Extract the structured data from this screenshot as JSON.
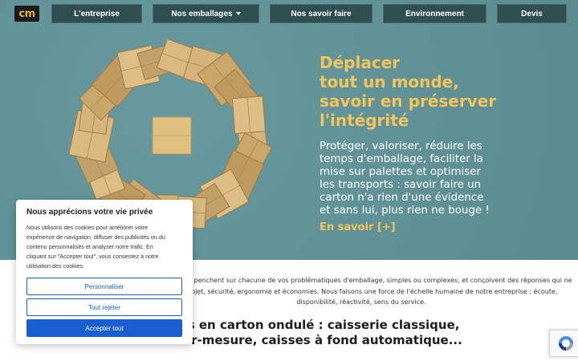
{
  "logo": {
    "text": "cm"
  },
  "nav": {
    "items": [
      {
        "label": "L'entreprise"
      },
      {
        "label": "Nos emballages"
      },
      {
        "label": "Nos savoir faire"
      },
      {
        "label": "Environnement"
      },
      {
        "label": "Devis"
      }
    ]
  },
  "hero": {
    "title_lines": [
      "Déplacer",
      "tout un monde,",
      "savoir en préserver",
      "l'intégrité"
    ],
    "text_lines": [
      "Protéger, valoriser, réduire les",
      "temps d'emballage, faciliter la",
      "mise sur palettes et optimiser",
      "les transports : savoir faire un",
      "carton n'a rien d'une évidence",
      "et sans lui, plus rien ne bouge !"
    ],
    "link": "En savoir [+]"
  },
  "intro": {
    "lines": [
      "se penchent sur chacune de vos problématiques d'emballage, simples ou complexes, et conçoivent des réponses qui ne",
      "projet, sécurité, ergonomie et économies. Nous faisons une force de l'échelle humaine de notre entreprise : écoute,",
      "disponibilité, réactivité, sens du service."
    ]
  },
  "heading2": {
    "lines": [
      "lages en carton ondulé : caisserie classique,",
      "es sur-mesure, caisses à fond automatique..."
    ]
  },
  "cookie": {
    "title": "Nous apprécions votre vie privée",
    "body_lines": [
      "Nous utilisons des cookies pour améliorer votre",
      "expérience de navigation, diffuser des publicités ou du",
      "contenu personnalisés et analyser notre trafic. En",
      "cliquant sur \"Accepter tout\", vous consentez à notre",
      "utilisation des cookies."
    ],
    "customize": "Personnaliser",
    "reject": "Tout rejeter",
    "accept": "Accepter tout"
  },
  "colors": {
    "hero_bg": "#5f9399",
    "nav_bg": "#2f4f50",
    "accent": "#f2c45a",
    "button_blue": "#1a5fd1"
  },
  "icons": {
    "recaptcha": "recaptcha-icon",
    "caret": "chevron-down-icon"
  }
}
